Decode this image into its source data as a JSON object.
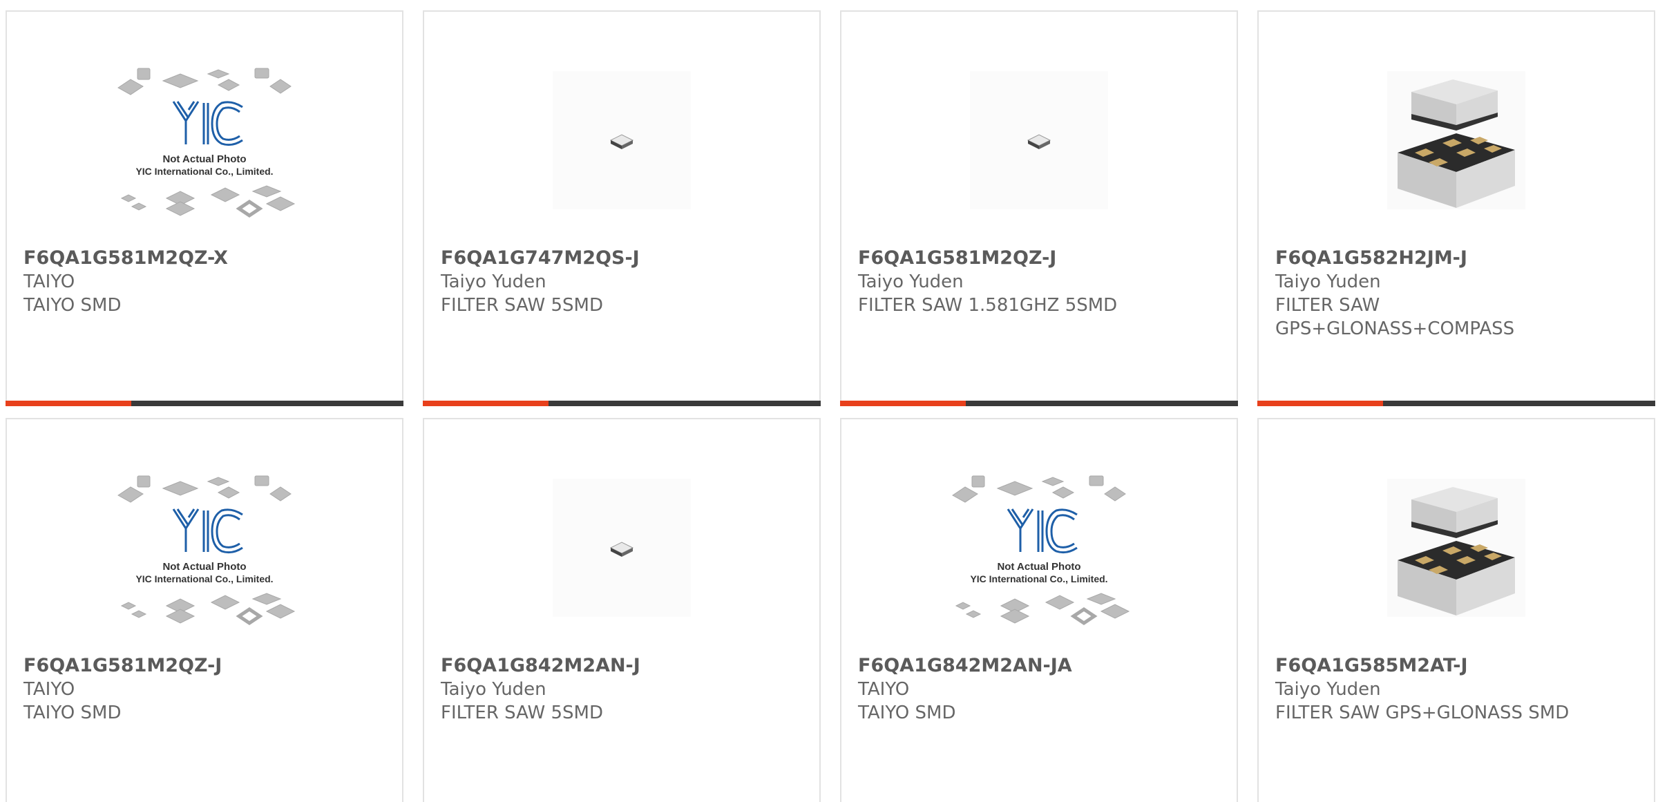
{
  "products": [
    {
      "part": "F6QA1G581M2QZ-X",
      "mfr": "TAIYO",
      "desc": "TAIYO SMD",
      "image": "yic-placeholder-icon"
    },
    {
      "part": "F6QA1G747M2QS-J",
      "mfr": "Taiyo Yuden",
      "desc": "FILTER SAW 5SMD",
      "image": "tiny-chip-icon"
    },
    {
      "part": "F6QA1G581M2QZ-J",
      "mfr": "Taiyo Yuden",
      "desc": "FILTER SAW 1.581GHZ 5SMD",
      "image": "tiny-chip-icon"
    },
    {
      "part": "F6QA1G582H2JM-J",
      "mfr": "Taiyo Yuden",
      "desc": "FILTER SAW\nGPS+GLONASS+COMPASS",
      "image": "saw-package-icon"
    },
    {
      "part": "F6QA1G581M2QZ-J",
      "mfr": "TAIYO",
      "desc": "TAIYO SMD",
      "image": "yic-placeholder-icon"
    },
    {
      "part": "F6QA1G842M2AN-J",
      "mfr": "Taiyo Yuden",
      "desc": "FILTER SAW 5SMD",
      "image": "tiny-chip-icon"
    },
    {
      "part": "F6QA1G842M2AN-JA",
      "mfr": "TAIYO",
      "desc": "TAIYO SMD",
      "image": "yic-placeholder-icon"
    },
    {
      "part": "F6QA1G585M2AT-J",
      "mfr": "Taiyo Yuden",
      "desc": "FILTER SAW GPS+GLONASS SMD",
      "image": "saw-package-icon"
    }
  ],
  "placeholder": {
    "brand": "YIC",
    "line1": "Not Actual Photo",
    "line2": "YIC International Co., Limited."
  },
  "colors": {
    "accent": "#e8401c",
    "bar": "#3a3a3a",
    "border": "#e2e2e2",
    "text": "#5a5a5a"
  }
}
